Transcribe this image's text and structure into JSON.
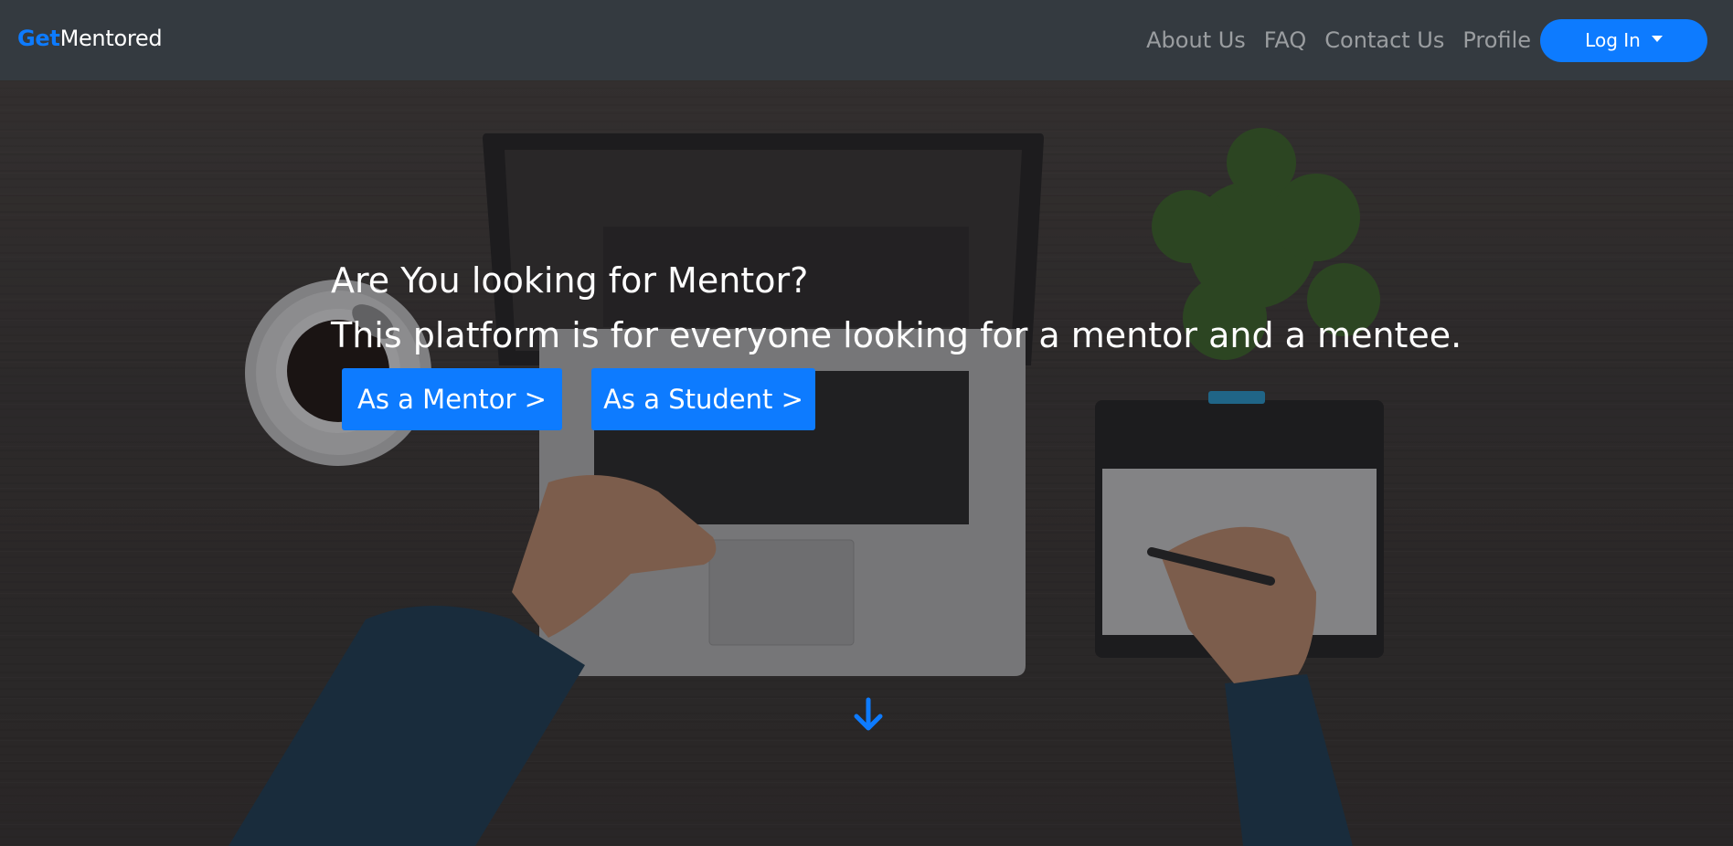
{
  "brand": {
    "prefix": "Get",
    "suffix": "Mentored"
  },
  "nav": {
    "links": [
      "About Us",
      "FAQ",
      "Contact Us",
      "Profile"
    ],
    "login_label": "Log In"
  },
  "hero": {
    "line1": "Are You looking for Mentor?",
    "line2": "This platform is for everyone looking for a mentor and a mentee.",
    "mentor_button": "As a Mentor >",
    "student_button": "As a Student >"
  },
  "colors": {
    "accent": "#0d7bff",
    "navbar": "#343a40"
  },
  "icons": {
    "scroll": "arrow-down-icon",
    "login_caret": "caret-down-icon"
  }
}
